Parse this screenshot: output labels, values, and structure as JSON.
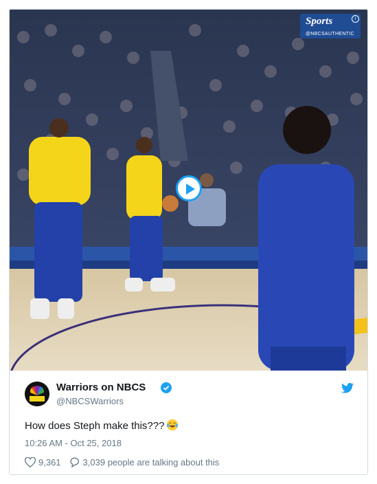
{
  "video": {
    "watermark_title": "Sports",
    "watermark_sub": "@NBCSAUTHENTIC",
    "watermark_info": "i"
  },
  "tweet": {
    "author_name": "Warriors on NBCS",
    "handle": "@NBCSWarriors",
    "text": "How does Steph make this???",
    "emoji": "face-with-tears-of-joy",
    "timestamp": "10:26 AM - Oct 25, 2018",
    "likes": "9,361",
    "talking": "3,039 people are talking about this"
  },
  "colors": {
    "twitter_blue": "#1da1f2",
    "warriors_yellow": "#f5d51a",
    "warriors_blue": "#2341a8",
    "like_red": "#e0245e"
  }
}
